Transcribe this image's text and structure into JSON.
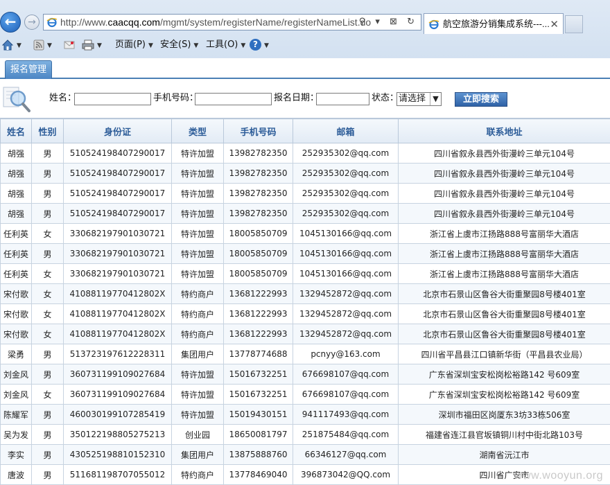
{
  "browser": {
    "url_prefix": "http://www.",
    "url_domain": "caacqq.com",
    "url_path": "/mgmt/system/registerName/registerNameList.do",
    "address_icons": "⚲ ▾ ⊠ ↻",
    "tab_title": "航空旅游分销集成系统---...",
    "tab_close": "✕",
    "back": "←",
    "forward": "→",
    "menu": {
      "page": "页面(P)",
      "safety": "安全(S)",
      "tools": "工具(O)",
      "help": "?"
    }
  },
  "app": {
    "tab_label": "报名管理"
  },
  "search": {
    "name_label": "姓名：",
    "phone_label": "手机号码：",
    "date_label": "报名日期：",
    "status_label": "状态：",
    "status_value": "请选择",
    "button_label": "立即搜索"
  },
  "table": {
    "headers": [
      "姓名",
      "性别",
      "身份证",
      "类型",
      "手机号码",
      "邮箱",
      "联系地址"
    ],
    "rows": [
      [
        "胡强",
        "男",
        "510524198407290017",
        "特许加盟",
        "13982782350",
        "252935302@qq.com",
        "四川省叙永县西外街漫岭三单元104号"
      ],
      [
        "胡强",
        "男",
        "510524198407290017",
        "特许加盟",
        "13982782350",
        "252935302@qq.com",
        "四川省叙永县西外街漫岭三单元104号"
      ],
      [
        "胡强",
        "男",
        "510524198407290017",
        "特许加盟",
        "13982782350",
        "252935302@qq.com",
        "四川省叙永县西外街漫岭三单元104号"
      ],
      [
        "胡强",
        "男",
        "510524198407290017",
        "特许加盟",
        "13982782350",
        "252935302@qq.com",
        "四川省叙永县西外街漫岭三单元104号"
      ],
      [
        "任利英",
        "女",
        "330682197901030721",
        "特许加盟",
        "18005850709",
        "1045130166@qq.com",
        "浙江省上虞市江扬路888号富丽华大酒店"
      ],
      [
        "任利英",
        "男",
        "330682197901030721",
        "特许加盟",
        "18005850709",
        "1045130166@qq.com",
        "浙江省上虞市江扬路888号富丽华大酒店"
      ],
      [
        "任利英",
        "女",
        "330682197901030721",
        "特许加盟",
        "18005850709",
        "1045130166@qq.com",
        "浙江省上虞市江扬路888号富丽华大酒店"
      ],
      [
        "宋付歌",
        "女",
        "41088119770412802X",
        "特约商户",
        "13681222993",
        "1329452872@qq.com",
        "北京市石景山区鲁谷大街重聚园8号楼401室"
      ],
      [
        "宋付歌",
        "女",
        "41088119770412802X",
        "特约商户",
        "13681222993",
        "1329452872@qq.com",
        "北京市石景山区鲁谷大街重聚园8号楼401室"
      ],
      [
        "宋付歌",
        "女",
        "41088119770412802X",
        "特约商户",
        "13681222993",
        "1329452872@qq.com",
        "北京市石景山区鲁谷大街重聚园8号楼401室"
      ],
      [
        "梁勇",
        "男",
        "513723197612228311",
        "集团用户",
        "13778774688",
        "pcnyy@163.com",
        "四川省平昌县江口镇新华街（平昌县农业局）"
      ],
      [
        "刘金风",
        "男",
        "360731199109027684",
        "特许加盟",
        "15016732251",
        "676698107@qq.com",
        "广东省深圳宝安松岗松裕路142 号609室"
      ],
      [
        "刘金风",
        "女",
        "360731199109027684",
        "特许加盟",
        "15016732251",
        "676698107@qq.com",
        "广东省深圳宝安松岗松裕路142 号609室"
      ],
      [
        "陈耀军",
        "男",
        "460030199107285419",
        "特许加盟",
        "15019430151",
        "941117493@qq.com",
        "深圳市福田区岗厦东3坊33栋506室"
      ],
      [
        "吴为发",
        "男",
        "350122198805275213",
        "创业园",
        "18650081797",
        "251875484@qq.com",
        "福建省连江县官坂镇铜川村中街北路103号"
      ],
      [
        "李实",
        "男",
        "430525198810152310",
        "集团用户",
        "13875888760",
        "66346127@qq.com",
        "湖南省沅江市"
      ],
      [
        "唐波",
        "男",
        "511681198707055012",
        "特约商户",
        "13778469040",
        "396873042@QQ.com",
        "四川省广安市"
      ]
    ]
  },
  "watermark": "www.wooyun.org",
  "colors": {
    "header_text": "#2c5c98",
    "button": "#2f62a6",
    "tab": "#4c86c4"
  }
}
